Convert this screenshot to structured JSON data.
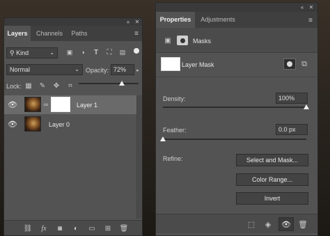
{
  "layers_panel": {
    "tabs": [
      "Layers",
      "Channels",
      "Paths"
    ],
    "filter_kind": "Kind",
    "blend_mode": "Normal",
    "opacity_label": "Opacity:",
    "opacity_value": "72%",
    "lock_label": "Lock:",
    "opacity_level_percent": 72,
    "layers": [
      {
        "name": "Layer 1",
        "visible": true,
        "selected": true,
        "has_mask": true
      },
      {
        "name": "Layer 0",
        "visible": true,
        "selected": false,
        "has_mask": false
      }
    ],
    "footer_icons": [
      "link-icon",
      "fx-icon",
      "add-mask-icon",
      "adjustment-icon",
      "folder-icon",
      "new-layer-icon",
      "trash-icon"
    ]
  },
  "properties_panel": {
    "tabs": [
      "Properties",
      "Adjustments"
    ],
    "section_title": "Masks",
    "mask_type": "Layer Mask",
    "density_label": "Density:",
    "density_value": "100%",
    "density_level_percent": 100,
    "feather_label": "Feather:",
    "feather_value": "0.0 px",
    "feather_level_percent": 0,
    "refine_label": "Refine:",
    "buttons": {
      "select_and_mask": "Select and Mask...",
      "color_range": "Color Range...",
      "invert": "Invert"
    },
    "footer_icons": [
      "selection-icon",
      "apply-mask-icon",
      "eye-icon",
      "trash-icon"
    ]
  },
  "colors": {
    "panel_bg": "#535353",
    "selected_row": "#6a6a6a",
    "tab_bar": "#3f3f3f"
  }
}
